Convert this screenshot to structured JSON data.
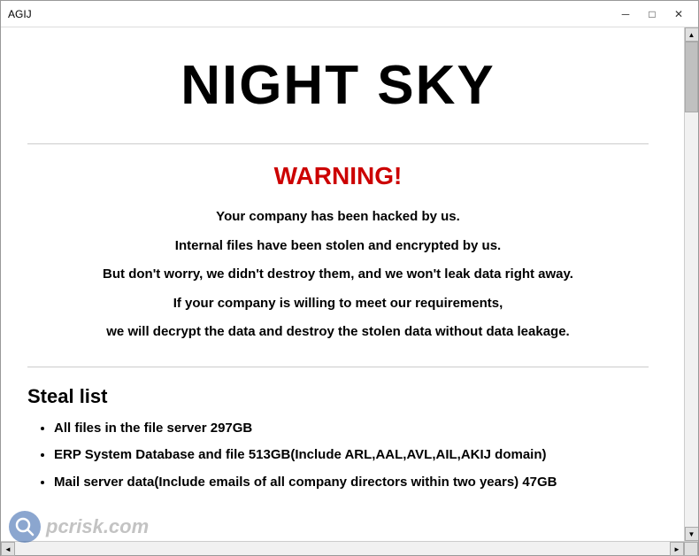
{
  "titlebar": {
    "title": "AGIJ",
    "minimize_label": "─",
    "maximize_label": "□",
    "close_label": "✕"
  },
  "main": {
    "title": "NIGHT SKY",
    "warning_heading": "WARNING!",
    "warning_lines": [
      "Your company has been hacked by us.",
      "Internal files have been stolen and encrypted by us.",
      "But don't worry, we didn't destroy them, and we won't leak data right away.",
      "If your company is willing to meet our requirements,",
      "we will decrypt the data and destroy the stolen data without data leakage."
    ],
    "steal_list_title": "Steal list",
    "steal_list_items": [
      "All files in the file server  297GB",
      "ERP System Database and file  513GB(Include ARL,AAL,AVL,AIL,AKIJ domain)",
      "Mail server data(Include emails of all company directors within two years)  47GB"
    ]
  },
  "watermark": {
    "text": "pcrisk.com",
    "icon_label": "🔍"
  }
}
